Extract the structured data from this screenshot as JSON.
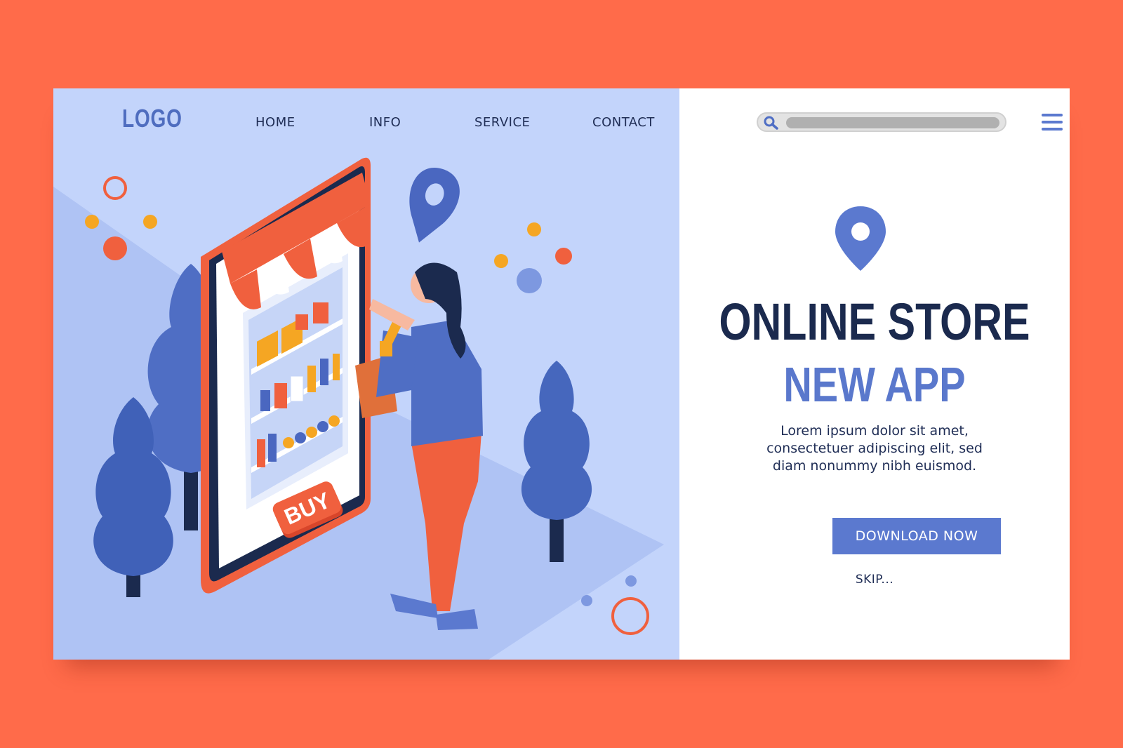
{
  "header": {
    "logo": "LOGO",
    "nav": [
      {
        "label": "HOME"
      },
      {
        "label": "INFO"
      },
      {
        "label": "SERVICE"
      },
      {
        "label": "CONTACT"
      }
    ]
  },
  "illustration": {
    "buy_sign": "BUY"
  },
  "hero": {
    "title": "ONLINE STORE",
    "subtitle": "NEW APP",
    "body_lines": [
      "Lorem ipsum dolor sit amet,",
      "consectetuer adipiscing elit, sed",
      "diam nonummy nibh euismod."
    ],
    "cta_label": "DOWNLOAD NOW",
    "skip_label": "SKIP..."
  },
  "icons": {
    "search": "search-icon",
    "menu": "hamburger-menu-icon",
    "location": "location-pin-icon"
  },
  "colors": {
    "background": "#ff6b4a",
    "left_panel": "#c3d4fb",
    "accent_blue": "#5b79cf",
    "navy": "#1b2a4e",
    "accent_orange": "#ff6b4a"
  }
}
